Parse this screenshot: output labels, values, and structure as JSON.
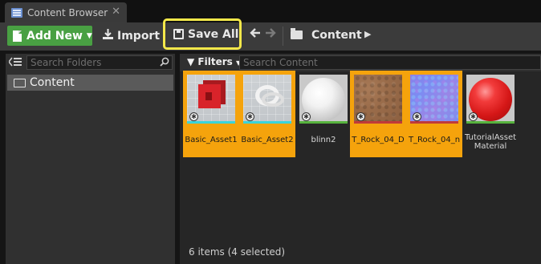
{
  "tab": {
    "label": "Content Browser",
    "close_glyph": "✕",
    "icon": "content-browser-icon"
  },
  "toolbar": {
    "add_new_label": "Add New",
    "import_label": "Import",
    "save_all_label": "Save All",
    "back_glyph": "🡐",
    "forward_glyph": "🡒",
    "path_label": "Content",
    "path_arrow": "▶"
  },
  "sources": {
    "search_placeholder": "Search Folders",
    "folders": [
      {
        "label": "Content",
        "selected": true
      }
    ]
  },
  "filters": {
    "label": "Filters",
    "search_placeholder": "Search Content"
  },
  "assets": [
    {
      "name": "Basic_Asset1",
      "selected": true,
      "thumb": "red-cube",
      "bar_color": "#3ad4d9"
    },
    {
      "name": "Basic_Asset2",
      "selected": true,
      "thumb": "white-knot",
      "bar_color": "#3ad4d9"
    },
    {
      "name": "blinn2",
      "selected": false,
      "thumb": "white-sphere",
      "bar_color": "#57b33e"
    },
    {
      "name": "T_Rock_04_D",
      "selected": true,
      "thumb": "rock-texture",
      "bar_color": "#c03a3a"
    },
    {
      "name": "T_Rock_04_n",
      "selected": true,
      "thumb": "normal-texture",
      "bar_color": "#c03a3a"
    },
    {
      "name": "TutorialAsset Material",
      "selected": false,
      "thumb": "red-sphere",
      "bar_color": "#57b33e"
    }
  ],
  "status": {
    "text": "6 items (4 selected)"
  },
  "colors": {
    "selection": "#f5a30c",
    "add_new": "#49a043",
    "highlight": "#f4e84a"
  }
}
